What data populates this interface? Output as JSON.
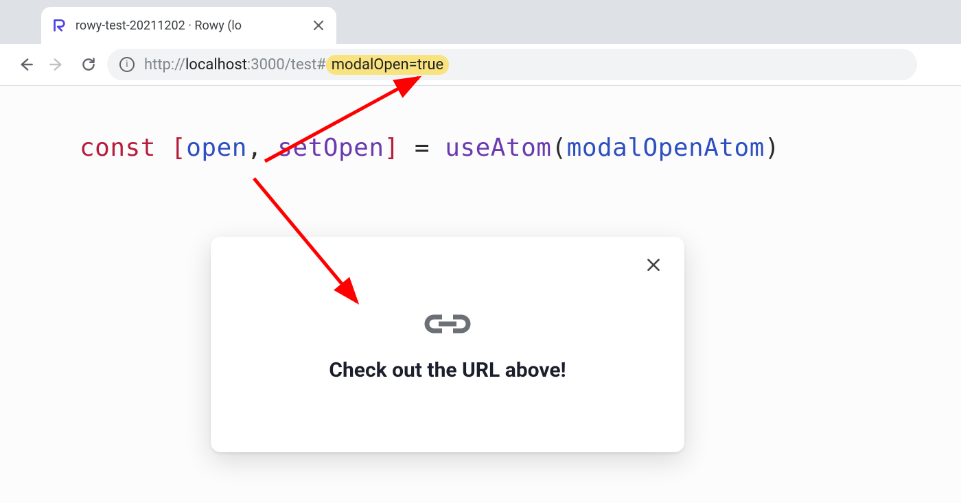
{
  "tab": {
    "title": "rowy-test-20211202 · Rowy (lo"
  },
  "url": {
    "scheme": "http://",
    "host": "localhost",
    "port_path": ":3000/test#",
    "hash_highlight": "modalOpen=true"
  },
  "code": {
    "const": "const",
    "lbr": " [",
    "open": "open",
    "comma": ", ",
    "setOpen": "setOpen",
    "rbr": "] ",
    "eq": "= ",
    "useAtom": "useAtom",
    "lp": "(",
    "atom": "modalOpenAtom",
    "rp": ")"
  },
  "modal": {
    "message": "Check out the URL above!"
  },
  "colors": {
    "highlight": "#f9e37e",
    "arrow": "#ff0000"
  }
}
